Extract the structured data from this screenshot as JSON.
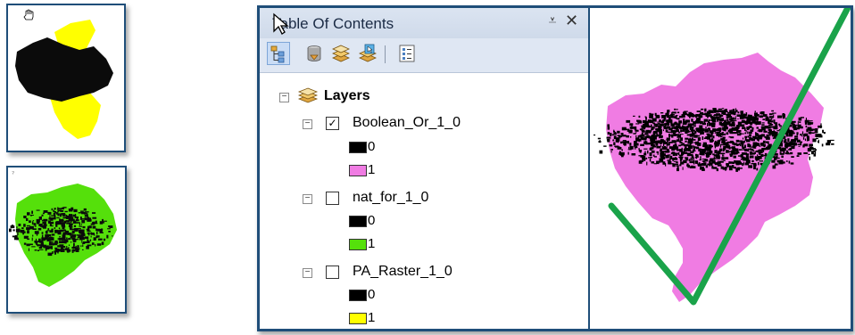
{
  "toc": {
    "title": "Table Of Contents",
    "pin_glyph": "⩡",
    "close_glyph": "✕",
    "toolbar": {
      "buttons": [
        "list-by-drawing-order-icon",
        "list-by-source-icon",
        "list-by-visibility-icon",
        "list-by-selection-icon",
        "options-icon"
      ]
    },
    "root": {
      "label": "Layers",
      "expander": "−",
      "icon": "layers-icon"
    },
    "layers": [
      {
        "name": "Boolean_Or_1_0",
        "checked": true,
        "check_glyph": "✓",
        "expander": "−",
        "classes": [
          {
            "label": "0",
            "color": "#000000"
          },
          {
            "label": "1",
            "color": "#f07ce3"
          }
        ]
      },
      {
        "name": "nat_for_1_0",
        "checked": false,
        "check_glyph": "",
        "expander": "−",
        "classes": [
          {
            "label": "0",
            "color": "#000000"
          },
          {
            "label": "1",
            "color": "#55e00b"
          }
        ]
      },
      {
        "name": "PA_Raster_1_0",
        "checked": false,
        "check_glyph": "",
        "expander": "−",
        "classes": [
          {
            "label": "0",
            "color": "#000000"
          },
          {
            "label": "1",
            "color": "#ffff00"
          }
        ]
      }
    ]
  },
  "thumbnails": {
    "top": {
      "fill_a": "#ffff00",
      "fill_b": "#0b0b0b"
    },
    "bottom": {
      "fill_a": "#55e00b",
      "fill_b": "#0b0b0b"
    }
  },
  "map": {
    "land_color": "#f07ce3",
    "overlay_color": "#000000",
    "checkmark_color": "#1aa34a"
  },
  "colors": {
    "frame_border": "#1f4e79",
    "titlebar": "#d6e0ee"
  }
}
